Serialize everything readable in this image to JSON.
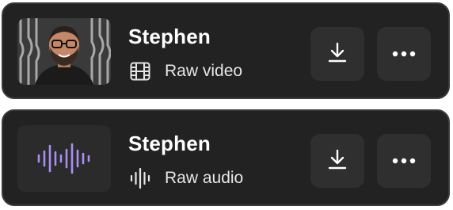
{
  "items": [
    {
      "title": "Stephen",
      "type_label": "Raw video",
      "type_icon": "film-icon",
      "thumbnail": "video-thumbnail-person",
      "download_icon": "download-icon",
      "more_icon": "more-icon"
    },
    {
      "title": "Stephen",
      "type_label": "Raw audio",
      "type_icon": "audio-wave-icon",
      "thumbnail": "audio-waveform",
      "download_icon": "download-icon",
      "more_icon": "more-icon"
    }
  ],
  "colors": {
    "card_bg": "#222222",
    "card_border": "#3a3a3a",
    "button_bg": "#2f2f2f",
    "waveform": "#a98ff0"
  }
}
